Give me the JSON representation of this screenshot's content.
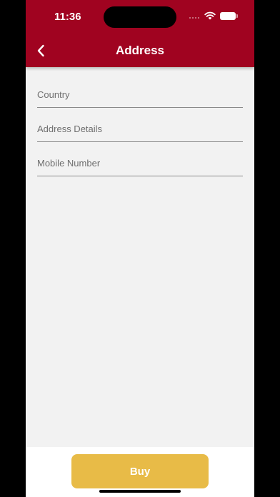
{
  "status_bar": {
    "time": "11:36",
    "icons": [
      "cellular-signal-icon",
      "wifi-icon",
      "battery-icon"
    ]
  },
  "nav": {
    "back_icon": "chevron-left-icon",
    "title": "Address"
  },
  "form": {
    "fields": [
      {
        "placeholder": "Country",
        "value": ""
      },
      {
        "placeholder": "Address Details",
        "value": ""
      },
      {
        "placeholder": "Mobile Number",
        "value": ""
      }
    ]
  },
  "actions": {
    "buy_label": "Buy"
  },
  "colors": {
    "header": "#a00320",
    "background": "#f2f2f2",
    "buy_button": "#e8bb47",
    "field_underline": "#8a8a8a"
  }
}
